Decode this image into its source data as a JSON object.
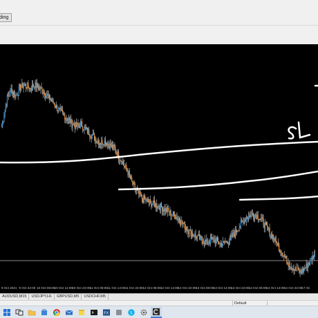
{
  "window": {
    "tab_label": "ding"
  },
  "chart": {
    "colors": {
      "background": "#000000",
      "bull_candle": "#2e8fd6",
      "bear_candle": "#f2923a",
      "wick": "#cfcfcf",
      "drawing": "#ffffff",
      "level_line": "#8a8a8a",
      "time_label": "#c8c8c8"
    },
    "annotation_text": "SL",
    "annotation_text_2": "T",
    "time_labels": [
      "9 Oct 2021",
      "9 Oct 22:00",
      "10 Oct 06:00",
      "10 Oct 14:00",
      "10 Oct 22:00",
      "11 Oct 06:00",
      "11 Oct 14:00",
      "11 Oct 22:00",
      "12 Oct 06:00",
      "12 Oct 14:00",
      "12 Oct 22:00",
      "13 Oct 06:00",
      "13 Oct 14:00",
      "13 Oct 22:00",
      "14 Oct 06:00",
      "14 Oct 14:00",
      "14 Oct 22:00",
      "17 Oc"
    ],
    "close_series": [
      1.1785,
      1.184,
      1.1862,
      1.185,
      1.1868,
      1.1872,
      1.1865,
      1.1872,
      1.1866,
      1.1858,
      1.1846,
      1.1836,
      1.1822,
      1.1812,
      1.1802,
      1.1792,
      1.1786,
      1.179,
      1.1778,
      1.177,
      1.176,
      1.1752,
      1.1755,
      1.1747,
      1.174,
      1.1725,
      1.1708,
      1.169,
      1.1665,
      1.1648,
      1.1636,
      1.163,
      1.1626,
      1.1622,
      1.1618,
      1.1612,
      1.1606,
      1.16,
      1.1592,
      1.158,
      1.1568,
      1.156,
      1.1554,
      1.1548,
      1.1544,
      1.155,
      1.1546,
      1.154,
      1.1545,
      1.1552,
      1.1565,
      1.158,
      1.1592,
      1.16,
      1.1603,
      1.1598,
      1.1585,
      1.157,
      1.1556,
      1.154,
      1.1522,
      1.1506,
      1.1494,
      1.1486,
      1.1482,
      1.1492,
      1.1506,
      1.152
    ]
  },
  "symbol_tabs": [
    "AUDUSD,M15",
    "USDJPY,H1",
    "GBPUSD,M5",
    "USDCHF,M5"
  ],
  "status": {
    "profile": "Default"
  },
  "taskbar": {
    "icons": [
      "windows-logo",
      "task-view",
      "file-explorer",
      "store",
      "chrome",
      "mail",
      "sticky-notes",
      "terminal",
      "photos",
      "app",
      "skype",
      "settings",
      "c-app"
    ]
  }
}
